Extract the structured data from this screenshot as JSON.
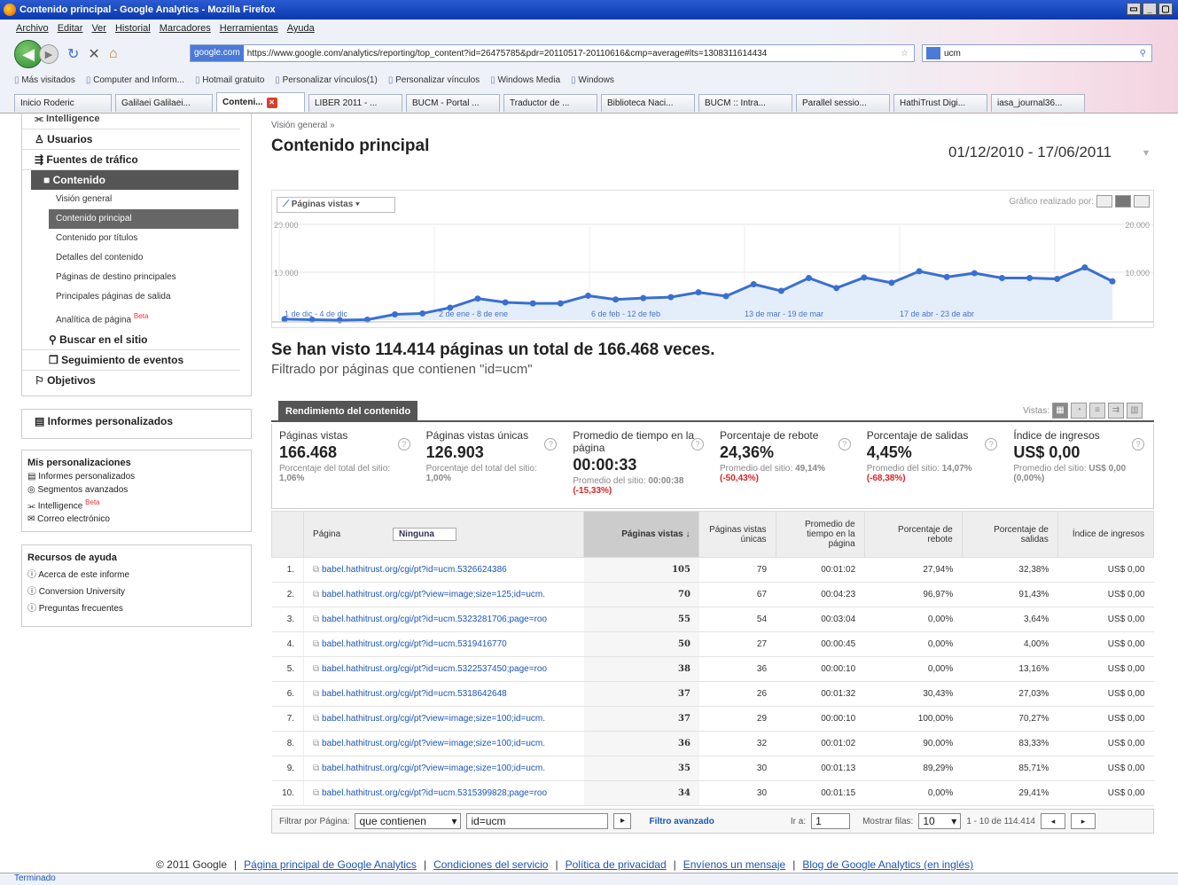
{
  "window": {
    "title": "Contenido principal - Google Analytics - Mozilla Firefox"
  },
  "menu": [
    "Archivo",
    "Editar",
    "Ver",
    "Historial",
    "Marcadores",
    "Herramientas",
    "Ayuda"
  ],
  "url": {
    "site": "google.com",
    "value": "https://www.google.com/analytics/reporting/top_content?id=26475785&pdr=20110517-20110616&cmp=average#lts=1308311614434"
  },
  "search": {
    "value": "ucm"
  },
  "bookmarks": [
    "Más visitados",
    "Computer and Inform...",
    "Hotmail gratuito",
    "Personalizar vínculos(1)",
    "Personalizar vínculos",
    "Windows Media",
    "Windows"
  ],
  "tabs": [
    "Inicio Roderic",
    "Galilaei Galilaei...",
    "Conteni...",
    "LIBER 2011 - ...",
    "BUCM - Portal ...",
    "Traductor de ...",
    "Biblioteca Naci...",
    "BUCM :: Intra...",
    "Parallel sessio...",
    "HathiTrust Digi...",
    "iasa_journal36..."
  ],
  "sidebar": {
    "intelligence": "Intelligence",
    "usuarios": "Usuarios",
    "fuentes": "Fuentes de tráfico",
    "contenido": "Contenido",
    "items": [
      "Visión general",
      "Contenido principal",
      "Contenido por títulos",
      "Detalles del contenido",
      "Páginas de destino principales",
      "Principales páginas de salida",
      "Analítica de página"
    ],
    "beta": "Beta",
    "buscar": "Buscar en el sitio",
    "eventos": "Seguimiento de eventos",
    "objetivos": "Objetivos",
    "informes": "Informes personalizados",
    "pers_title": "Mis personalizaciones",
    "pers_items": [
      "Informes personalizados",
      "Segmentos avanzados",
      "Intelligence",
      "Correo electrónico"
    ],
    "help_title": "Recursos de ayuda",
    "help_items": [
      "Acerca de este informe",
      "Conversion University",
      "Preguntas frecuentes"
    ]
  },
  "main": {
    "breadcrumb": "Visión general »",
    "title": "Contenido principal",
    "daterange": "01/12/2010 - 17/06/2011",
    "metric_selector": "Páginas vistas",
    "chart_by": "Gráfico realizado por:",
    "headline": "Se han visto 114.414 páginas un total de 166.468 veces.",
    "subheadline": "Filtrado por páginas que contienen \"id=ucm\"",
    "perf_tab": "Rendimiento del contenido",
    "views_label": "Vistas:"
  },
  "chart_data": {
    "type": "line",
    "ylim": [
      0,
      20000
    ],
    "yticks": [
      "20.000",
      "10.000"
    ],
    "x_labels": [
      "1 de dic - 4 de dic",
      "2 de ene - 8 de ene",
      "6 de feb - 12 de feb",
      "13 de mar - 19 de mar",
      "17 de abr - 23 de abr"
    ],
    "values": [
      200,
      100,
      0,
      100,
      1200,
      1400,
      2600,
      4500,
      3700,
      3500,
      3500,
      5100,
      4300,
      4600,
      4800,
      5800,
      5000,
      7500,
      6100,
      8800,
      6700,
      8900,
      7800,
      10200,
      9000,
      9800,
      8800,
      8800,
      8600,
      11000,
      8100
    ],
    "color": "#3a6fd2"
  },
  "metrics": [
    {
      "label": "Páginas vistas",
      "value": "166.468",
      "sub": "Porcentaje del total del sitio: ",
      "sub_b": "1,06%"
    },
    {
      "label": "Páginas vistas únicas",
      "value": "126.903",
      "sub": "Porcentaje del total del sitio: ",
      "sub_b": "1,00%"
    },
    {
      "label": "Promedio de tiempo en la página",
      "value": "00:00:33",
      "sub": "Promedio del sitio: ",
      "sub_b": "00:00:38 ",
      "sub_neg": "(-15,33%)"
    },
    {
      "label": "Porcentaje de rebote",
      "value": "24,36%",
      "sub": "Promedio del sitio: ",
      "sub_b": "49,14% ",
      "sub_neg": "(-50,43%)"
    },
    {
      "label": "Porcentaje de salidas",
      "value": "4,45%",
      "sub": "Promedio del sitio: ",
      "sub_b": "14,07% ",
      "sub_neg": "(-68,38%)"
    },
    {
      "label": "Índice de ingresos",
      "value": "US$ 0,00",
      "sub": "Promedio del sitio: ",
      "sub_b": "US$ 0,00 (0,00%)"
    }
  ],
  "table": {
    "headers": [
      "Página",
      "Ninguna",
      "Páginas vistas",
      "Páginas vistas únicas",
      "Promedio de tiempo en la página",
      "Porcentaje de rebote",
      "Porcentaje de salidas",
      "Índice de ingresos"
    ],
    "rows": [
      [
        "1.",
        "babel.hathitrust.org/cgi/pt?id=ucm.5326624386",
        "105",
        "79",
        "00:01:02",
        "27,94%",
        "32,38%",
        "US$ 0,00"
      ],
      [
        "2.",
        "babel.hathitrust.org/cgi/pt?view=image;size=125;id=ucm.",
        "70",
        "67",
        "00:04:23",
        "96,97%",
        "91,43%",
        "US$ 0,00"
      ],
      [
        "3.",
        "babel.hathitrust.org/cgi/pt?id=ucm.5323281706;page=roo",
        "55",
        "54",
        "00:03:04",
        "0,00%",
        "3,64%",
        "US$ 0,00"
      ],
      [
        "4.",
        "babel.hathitrust.org/cgi/pt?id=ucm.5319416770",
        "50",
        "27",
        "00:00:45",
        "0,00%",
        "4,00%",
        "US$ 0,00"
      ],
      [
        "5.",
        "babel.hathitrust.org/cgi/pt?id=ucm.5322537450;page=roo",
        "38",
        "36",
        "00:00:10",
        "0,00%",
        "13,16%",
        "US$ 0,00"
      ],
      [
        "6.",
        "babel.hathitrust.org/cgi/pt?id=ucm.5318642648",
        "37",
        "26",
        "00:01:32",
        "30,43%",
        "27,03%",
        "US$ 0,00"
      ],
      [
        "7.",
        "babel.hathitrust.org/cgi/pt?view=image;size=100;id=ucm.",
        "37",
        "29",
        "00:00:10",
        "100,00%",
        "70,27%",
        "US$ 0,00"
      ],
      [
        "8.",
        "babel.hathitrust.org/cgi/pt?view=image;size=100;id=ucm.",
        "36",
        "32",
        "00:01:02",
        "90,00%",
        "83,33%",
        "US$ 0,00"
      ],
      [
        "9.",
        "babel.hathitrust.org/cgi/pt?view=image;size=100;id=ucm.",
        "35",
        "30",
        "00:01:13",
        "89,29%",
        "85,71%",
        "US$ 0,00"
      ],
      [
        "10.",
        "babel.hathitrust.org/cgi/pt?id=ucm.5315399828;page=roo",
        "34",
        "30",
        "00:01:15",
        "0,00%",
        "29,41%",
        "US$ 0,00"
      ]
    ]
  },
  "filter": {
    "label": "Filtrar por Página:",
    "op": "que contienen",
    "value": "id=ucm",
    "advanced": "Filtro avanzado",
    "goto_label": "Ir a:",
    "goto_value": "1",
    "show_label": "Mostrar filas:",
    "show_value": "10",
    "range": "1 - 10 de 114.414"
  },
  "footer": {
    "copyright": "© 2011 Google",
    "links": [
      "Página principal de Google Analytics",
      "Condiciones del servicio",
      "Política de privacidad",
      "Envíenos un mensaje",
      "Blog de Google Analytics (en inglés)"
    ]
  },
  "status": "Terminado"
}
